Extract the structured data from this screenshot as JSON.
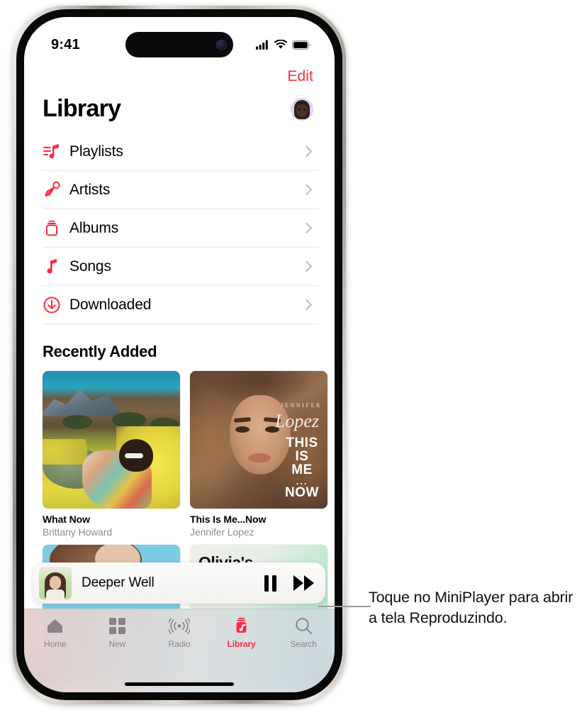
{
  "status_bar": {
    "time": "9:41",
    "cellular_icon": "cellular-signal-icon",
    "wifi_icon": "wifi-icon",
    "battery_icon": "battery-icon"
  },
  "header": {
    "edit_label": "Edit",
    "title": "Library",
    "avatar_icon": "memoji-avatar"
  },
  "library_list": [
    {
      "label": "Playlists",
      "icon": "playlist-note-icon"
    },
    {
      "label": "Artists",
      "icon": "microphone-icon"
    },
    {
      "label": "Albums",
      "icon": "album-stack-icon"
    },
    {
      "label": "Songs",
      "icon": "music-note-icon"
    },
    {
      "label": "Downloaded",
      "icon": "download-arrow-icon"
    }
  ],
  "recently_added": {
    "heading": "Recently Added",
    "items": [
      {
        "title": "What Now",
        "artist": "Brittany Howard",
        "artwork": "desert-wildflowers-artwork"
      },
      {
        "title": "This Is Me...Now",
        "artist": "Jennifer Lopez",
        "artwork": "jennifer-lopez-portrait-artwork",
        "art_text": {
          "name": "JENNIFER",
          "script": "Lopez",
          "line1": "THIS",
          "line2": "IS",
          "line3": "ME",
          "dots": "...",
          "line4": "NOW"
        }
      },
      {
        "title": "",
        "artist": "",
        "artwork": "blue-sky-portrait-artwork"
      },
      {
        "title": "",
        "artist": "",
        "artwork": "olivias-mint-artwork",
        "art_text": {
          "label": "Olivia's"
        }
      }
    ]
  },
  "miniplayer": {
    "track_title": "Deeper Well",
    "artwork": "deeper-well-artwork",
    "pause_icon": "pause-icon",
    "forward_icon": "fast-forward-icon"
  },
  "tab_bar": {
    "active": "Library",
    "tabs": [
      {
        "label": "Home",
        "icon": "house-icon"
      },
      {
        "label": "New",
        "icon": "grid-squares-icon"
      },
      {
        "label": "Radio",
        "icon": "broadcast-waves-icon"
      },
      {
        "label": "Library",
        "icon": "library-stack-icon"
      },
      {
        "label": "Search",
        "icon": "magnifier-icon"
      }
    ]
  },
  "callout": {
    "text": "Toque no MiniPlayer para abrir a tela Reproduzindo."
  },
  "colors": {
    "accent_red": "#fa2b42",
    "edit_red": "#ff2d3f",
    "secondary_text": "#8e8e93",
    "separator": "#e6e6e8",
    "chevron": "#bcbcc0"
  }
}
